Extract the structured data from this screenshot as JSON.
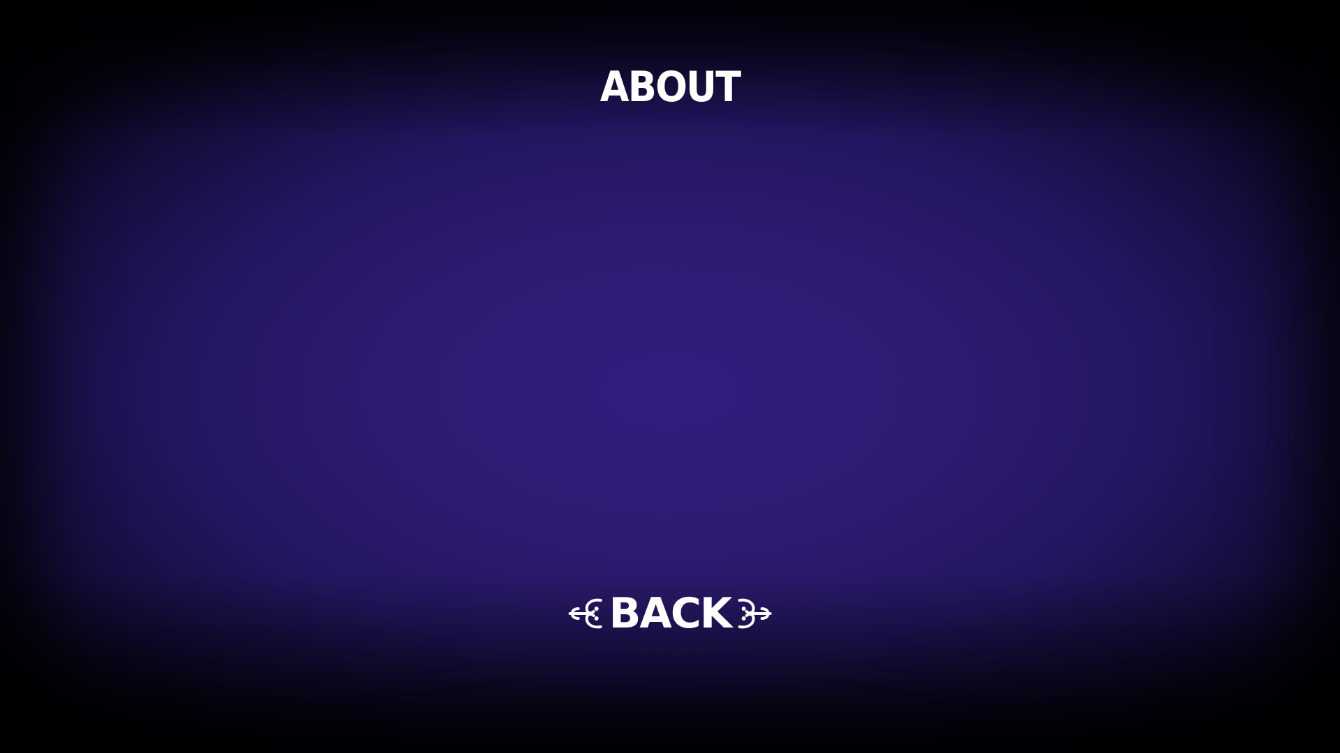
{
  "screen": {
    "title": "ABOUT"
  },
  "back_button": {
    "label": "BACK",
    "left_icon": "flourish-left-icon",
    "right_icon": "flourish-right-icon"
  },
  "colors": {
    "background_center": "#331d7e",
    "background_edge": "#05030d",
    "text": "#ffffff"
  }
}
